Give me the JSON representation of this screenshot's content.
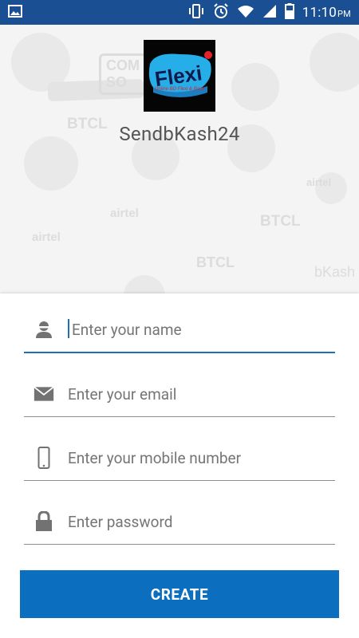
{
  "status_bar": {
    "time": "11:10",
    "ampm": "PM",
    "icons": [
      "image-icon",
      "vibrate-icon",
      "alarm-icon",
      "wifi-icon",
      "signal-icon",
      "battery-icon"
    ]
  },
  "header": {
    "logo_text": "Flexi",
    "logo_subtitle": "Online BD Flexi & Bank",
    "app_name": "SendbKash24"
  },
  "form": {
    "name_placeholder": "Enter your name",
    "email_placeholder": "Enter your email",
    "mobile_placeholder": "Enter your mobile number",
    "password_placeholder": "Enter password",
    "create_label": "CREATE"
  },
  "colors": {
    "status_bar": "#1b4f93",
    "accent": "#1f6fb8",
    "button": "#0c6ebf"
  }
}
